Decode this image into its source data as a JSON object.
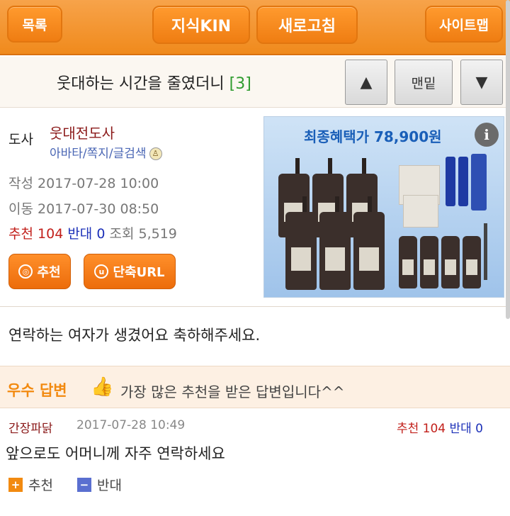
{
  "header": {
    "list_label": "목록",
    "kin_label": "지식KIN",
    "refresh_label": "새로고침",
    "sitemap_label": "사이트맵"
  },
  "post": {
    "title": "웃대하는 시간을 줄였더니",
    "reply_count": "[3]",
    "nav_up": "▲",
    "nav_bottom": "맨밑",
    "nav_down": "▼",
    "role": "도사",
    "author": "웃대전도사",
    "author_links": "아바타/쪽지/글검색",
    "written_label": "작성",
    "written_at": "2017-07-28 10:00",
    "moved_label": "이동",
    "moved_at": "2017-07-30 08:50",
    "recommend_label": "추천",
    "recommend_count": "104",
    "oppose_label": "반대",
    "oppose_count": "0",
    "views_label": "조회",
    "views_count": "5,519",
    "recommend_button": "추천",
    "short_url_button": "단축URL",
    "body": "연락하는 여자가 생겼어요 축하해주세요."
  },
  "ad": {
    "headline": "최종혜택가 78,900원",
    "info_icon": "i"
  },
  "best_answer": {
    "tag": "우수 답변",
    "description": "가장 많은 추천을 받은 답변입니다^^"
  },
  "reply": {
    "author": "간장파닭",
    "date": "2017-07-28 10:49",
    "recommend_label": "추천",
    "recommend_count": "104",
    "oppose_label": "반대",
    "oppose_count": "0",
    "text": "앞으로도 어머니께 자주 연락하세요",
    "recommend_button": "추천",
    "oppose_button": "반대"
  },
  "colors": {
    "brand_orange": "#f08a1c",
    "recommend_red": "#c2201b",
    "oppose_blue": "#1c30b8",
    "count_green": "#2e9b2e"
  }
}
